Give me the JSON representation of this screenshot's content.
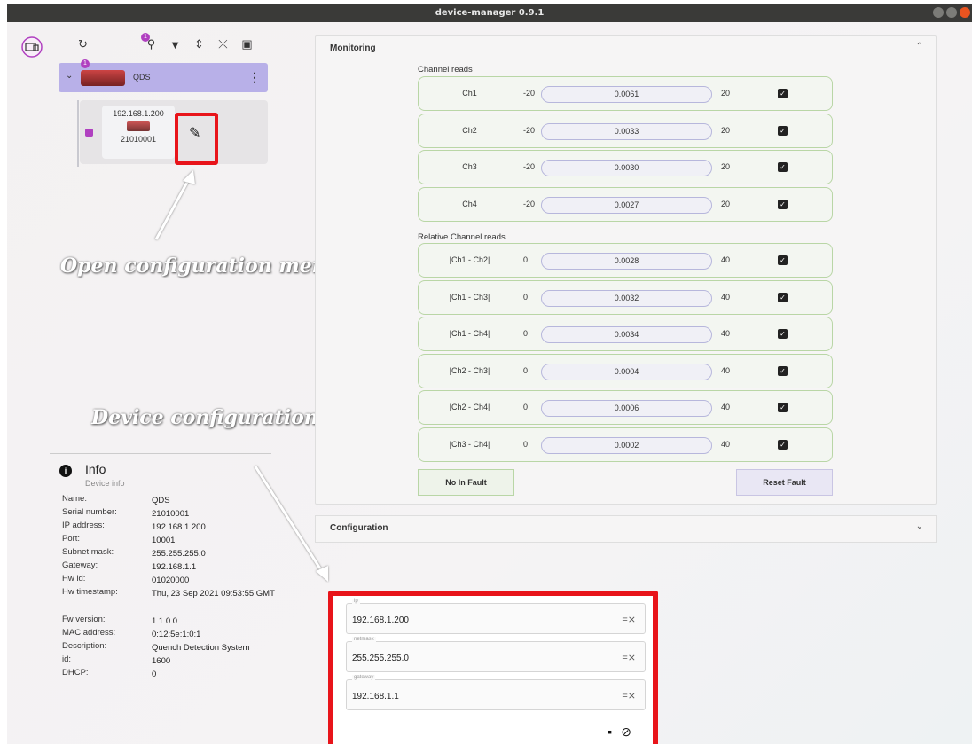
{
  "window": {
    "title": "device-manager 0.9.1"
  },
  "toolbar": {
    "badge_count": "1",
    "icons": [
      "refresh-icon",
      "search-icon",
      "filter-icon",
      "expand-icon",
      "collapse-icon",
      "calculator-icon"
    ]
  },
  "tree": {
    "group": {
      "name": "QDS",
      "badge": "1"
    },
    "device": {
      "ip": "192.168.1.200",
      "serial": "21010001"
    }
  },
  "annotations": {
    "open_config": "Open configuration menu",
    "device_config": "Device configuration"
  },
  "info": {
    "title": "Info",
    "subtitle": "Device info",
    "rows": [
      {
        "k": "Name:",
        "v": "QDS"
      },
      {
        "k": "Serial number:",
        "v": "21010001"
      },
      {
        "k": "IP address:",
        "v": "192.168.1.200"
      },
      {
        "k": "Port:",
        "v": "10001"
      },
      {
        "k": "Subnet mask:",
        "v": "255.255.255.0"
      },
      {
        "k": "Gateway:",
        "v": "192.168.1.1"
      },
      {
        "k": "Hw id:",
        "v": "01020000"
      },
      {
        "k": "Hw timestamp:",
        "v": "Thu, 23 Sep 2021 09:53:55 GMT"
      },
      {
        "k": "Fw version:",
        "v": "1.1.0.0"
      },
      {
        "k": "MAC address:",
        "v": "0:12:5e:1:0:1"
      },
      {
        "k": "Description:",
        "v": "Quench Detection System"
      },
      {
        "k": "id:",
        "v": "1600"
      },
      {
        "k": "DHCP:",
        "v": "0"
      }
    ]
  },
  "monitoring": {
    "title": "Monitoring",
    "channel_label": "Channel reads",
    "relative_label": "Relative Channel reads",
    "channels": [
      {
        "name": "Ch1",
        "min": "-20",
        "value": "0.0061",
        "max": "20"
      },
      {
        "name": "Ch2",
        "min": "-20",
        "value": "0.0033",
        "max": "20"
      },
      {
        "name": "Ch3",
        "min": "-20",
        "value": "0.0030",
        "max": "20"
      },
      {
        "name": "Ch4",
        "min": "-20",
        "value": "0.0027",
        "max": "20"
      }
    ],
    "relative": [
      {
        "name": "|Ch1 - Ch2|",
        "min": "0",
        "value": "0.0028",
        "max": "40"
      },
      {
        "name": "|Ch1 - Ch3|",
        "min": "0",
        "value": "0.0032",
        "max": "40"
      },
      {
        "name": "|Ch1 - Ch4|",
        "min": "0",
        "value": "0.0034",
        "max": "40"
      },
      {
        "name": "|Ch2 - Ch3|",
        "min": "0",
        "value": "0.0004",
        "max": "40"
      },
      {
        "name": "|Ch2 - Ch4|",
        "min": "0",
        "value": "0.0006",
        "max": "40"
      },
      {
        "name": "|Ch3 - Ch4|",
        "min": "0",
        "value": "0.0002",
        "max": "40"
      }
    ],
    "no_fault_label": "No In Fault",
    "reset_fault_label": "Reset Fault"
  },
  "configuration": {
    "title": "Configuration"
  },
  "dialog": {
    "fields": [
      {
        "label": "ip",
        "value": "192.168.1.200"
      },
      {
        "label": "netmask",
        "value": "255.255.255.0"
      },
      {
        "label": "gateway",
        "value": "192.168.1.1"
      }
    ]
  },
  "colors": {
    "accent": "#b040c0",
    "highlight": "#e8141a",
    "group_bg": "#b8b0e8"
  }
}
